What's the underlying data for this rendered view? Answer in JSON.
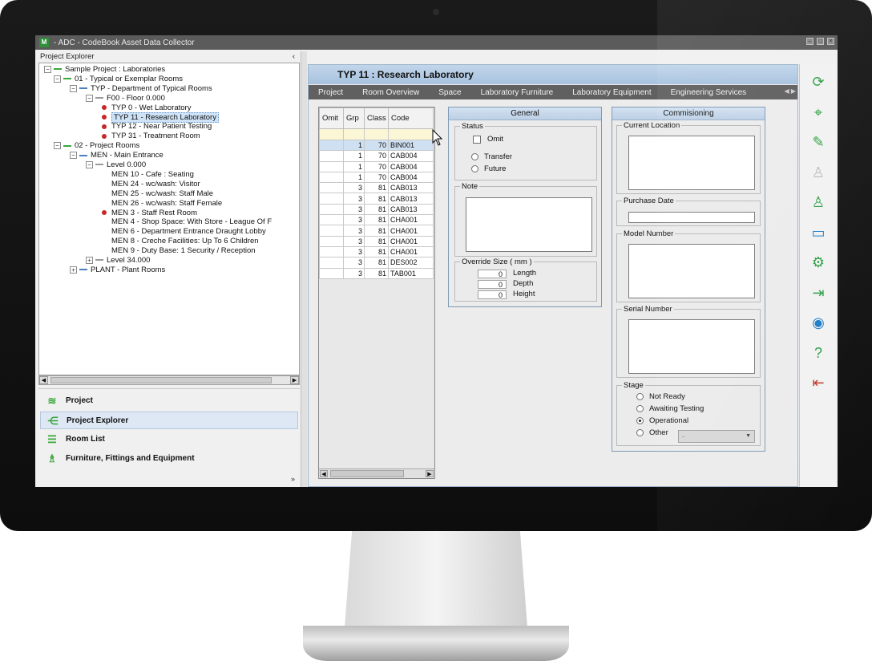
{
  "window": {
    "title": "- ADC - CodeBook Asset Data Collector",
    "app_icon": "M"
  },
  "left_panel": {
    "header": "Project Explorer",
    "collapse_glyph": "‹",
    "tree": [
      {
        "label": "Sample Project : Laboratories",
        "exp": "−",
        "kind": "root"
      },
      {
        "label": "01 - Typical or Exemplar Rooms",
        "exp": "−",
        "kind": "green"
      },
      {
        "label": "TYP - Department of Typical Rooms",
        "exp": "−",
        "kind": "blue"
      },
      {
        "label": "F00 - Floor 0.000",
        "exp": "−",
        "kind": "grey"
      },
      {
        "label": "TYP 0 - Wet Laboratory",
        "kind": "dot"
      },
      {
        "label": "TYP 11 - Research Laboratory",
        "kind": "dot",
        "selected": true
      },
      {
        "label": "TYP 12 - Near Patient Testing",
        "kind": "dot"
      },
      {
        "label": "TYP 31 - Treatment Room",
        "kind": "dot"
      },
      {
        "label": "02 - Project Rooms",
        "exp": "−",
        "kind": "green"
      },
      {
        "label": "MEN - Main Entrance",
        "exp": "−",
        "kind": "blue"
      },
      {
        "label": "Level 0.000",
        "exp": "−",
        "kind": "grey"
      },
      {
        "label": "MEN 10 - Cafe : Seating",
        "kind": "none"
      },
      {
        "label": "MEN 24 - wc/wash: Visitor",
        "kind": "none"
      },
      {
        "label": "MEN 25 - wc/wash: Staff Male",
        "kind": "none"
      },
      {
        "label": "MEN 26 - wc/wash: Staff Female",
        "kind": "none"
      },
      {
        "label": "MEN 3 - Staff Rest Room",
        "kind": "dot"
      },
      {
        "label": "MEN 4 - Shop Space: With Store - League Of F",
        "kind": "none"
      },
      {
        "label": "MEN 6 - Department Entrance Draught Lobby",
        "kind": "none"
      },
      {
        "label": "MEN 8 - Creche Facilities: Up To 6 Children",
        "kind": "none"
      },
      {
        "label": "MEN 9 - Duty Base: 1 Security / Reception",
        "kind": "none"
      },
      {
        "label": "Level 34.000",
        "exp": "+",
        "kind": "grey"
      },
      {
        "label": "PLANT - Plant Rooms",
        "exp": "+",
        "kind": "blue"
      }
    ],
    "nav": [
      {
        "label": "Project",
        "icon": "wifi-icon"
      },
      {
        "label": "Project Explorer",
        "icon": "hierarchy-icon",
        "active": true
      },
      {
        "label": "Room List",
        "icon": "list-icon"
      },
      {
        "label": "Furniture, Fittings and Equipment",
        "icon": "equipment-icon"
      }
    ]
  },
  "main": {
    "title": "TYP 11 : Research Laboratory",
    "tabs": [
      "Project",
      "Room Overview",
      "Space",
      "Laboratory Furniture",
      "Laboratory Equipment",
      "Engineering Services"
    ],
    "grid": {
      "columns": [
        "Omit",
        "Grp",
        "Class",
        "Code"
      ],
      "rows": [
        [
          "",
          "1",
          "70",
          "BIN001"
        ],
        [
          "",
          "1",
          "70",
          "CAB004"
        ],
        [
          "",
          "1",
          "70",
          "CAB004"
        ],
        [
          "",
          "1",
          "70",
          "CAB004"
        ],
        [
          "",
          "3",
          "81",
          "CAB013"
        ],
        [
          "",
          "3",
          "81",
          "CAB013"
        ],
        [
          "",
          "3",
          "81",
          "CAB013"
        ],
        [
          "",
          "3",
          "81",
          "CHA001"
        ],
        [
          "",
          "3",
          "81",
          "CHA001"
        ],
        [
          "",
          "3",
          "81",
          "CHA001"
        ],
        [
          "",
          "3",
          "81",
          "CHA001"
        ],
        [
          "",
          "3",
          "81",
          "DES002"
        ],
        [
          "",
          "3",
          "81",
          "TAB001"
        ]
      ]
    },
    "general": {
      "header": "General",
      "status_legend": "Status",
      "omit_label": "Omit",
      "transfer_label": "Transfer",
      "future_label": "Future",
      "note_legend": "Note",
      "override_legend": "Override Size ( mm )",
      "length_label": "Length",
      "depth_label": "Depth",
      "height_label": "Height",
      "length_value": "0",
      "depth_value": "0",
      "height_value": "0"
    },
    "commissioning": {
      "header": "Commisioning",
      "current_location": "Current Location",
      "purchase_date": "Purchase Date",
      "model_number": "Model Number",
      "serial_number": "Serial Number",
      "stage_legend": "Stage",
      "stage_options": [
        "Not Ready",
        "Awaiting Testing",
        "Operational",
        "Other"
      ],
      "stage_selected": "Operational",
      "other_dropdown": "-"
    }
  },
  "toolbar": [
    {
      "name": "refresh-icon",
      "glyph": "⟳",
      "tone": "green"
    },
    {
      "name": "certificate-icon",
      "glyph": "⌖",
      "tone": "green"
    },
    {
      "name": "edit-selection-icon",
      "glyph": "✎",
      "tone": "green"
    },
    {
      "name": "stamp-icon",
      "glyph": "♙",
      "tone": "grey"
    },
    {
      "name": "edit-stamp-icon",
      "glyph": "♙",
      "tone": "green"
    },
    {
      "name": "image-icon",
      "glyph": "▭",
      "tone": "blue"
    },
    {
      "name": "settings-icon",
      "glyph": "⚙",
      "tone": "green"
    },
    {
      "name": "export-icon",
      "glyph": "⇥",
      "tone": "green"
    },
    {
      "name": "wireless-icon",
      "glyph": "◉",
      "tone": "blue"
    },
    {
      "name": "help-icon",
      "glyph": "?",
      "tone": "green"
    },
    {
      "name": "exit-icon",
      "glyph": "⇤",
      "tone": "red"
    }
  ]
}
